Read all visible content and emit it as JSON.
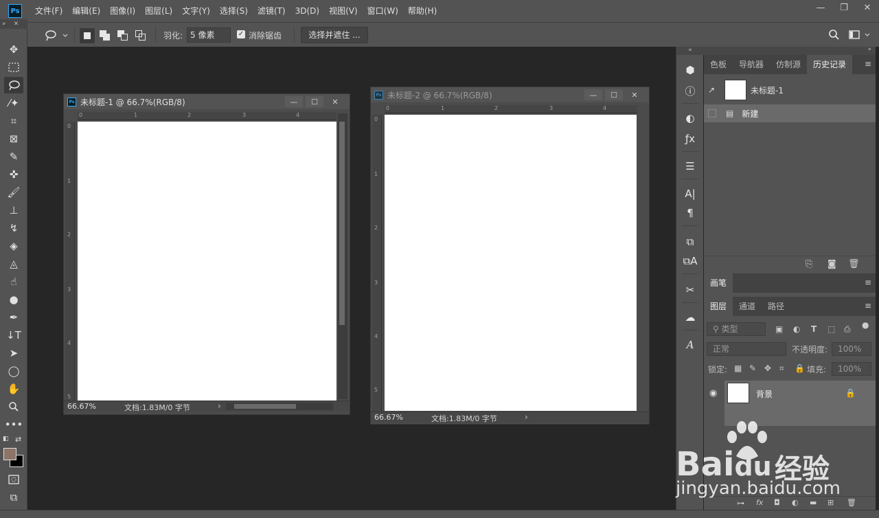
{
  "app": {
    "logo": "Ps",
    "menu": [
      "文件(F)",
      "编辑(E)",
      "图像(I)",
      "图层(L)",
      "文字(Y)",
      "选择(S)",
      "滤镜(T)",
      "3D(D)",
      "视图(V)",
      "窗口(W)",
      "帮助(H)"
    ],
    "window_controls": [
      "minimize-icon",
      "restore-icon",
      "close-icon"
    ]
  },
  "options": {
    "feather_label": "羽化:",
    "feather_value": "5 像素",
    "antialias_checked": true,
    "antialias_label": "消除锯齿",
    "select_mask_label": "选择并遮住 ..."
  },
  "documents": [
    {
      "title": "未标题-1 @ 66.7%(RGB/8)",
      "active": true,
      "zoom": "66.67%",
      "doc_info": "文档:1.83M/0 字节",
      "ruler_h": [
        "0",
        "1",
        "2",
        "3",
        "4"
      ],
      "ruler_v": [
        "0",
        "1",
        "2",
        "3",
        "4",
        "5"
      ]
    },
    {
      "title": "未标题-2 @ 66.7%(RGB/8)",
      "active": false,
      "zoom": "66.67%",
      "doc_info": "文档:1.83M/0 字节",
      "ruler_h": [
        "0",
        "1",
        "2",
        "3",
        "4"
      ],
      "ruler_v": [
        "0",
        "1",
        "2",
        "3",
        "4",
        "5"
      ]
    }
  ],
  "history_panel": {
    "tabs": [
      "色板",
      "导航器",
      "仿制源",
      "历史记录"
    ],
    "active_tab": "历史记录",
    "snapshot_label": "未标题-1",
    "items": [
      "新建"
    ]
  },
  "brush_panel": {
    "title": "画笔"
  },
  "layers_panel": {
    "tabs": [
      "图层",
      "通道",
      "路径"
    ],
    "filter_placeholder": "类型",
    "blend_mode": "正常",
    "opacity_label": "不透明度:",
    "opacity_value": "100%",
    "lock_label": "锁定:",
    "fill_label": "填充:",
    "fill_value": "100%",
    "layers": [
      {
        "name": "背景",
        "visible": true,
        "locked": true
      }
    ]
  },
  "colors": {
    "foreground": "#8c7468",
    "background": "#000000",
    "accent": "#31a8ff"
  },
  "watermark": {
    "brand": "Bai",
    "brand2": "du",
    "cn": "经验",
    "url": "jingyan.baidu.com"
  }
}
